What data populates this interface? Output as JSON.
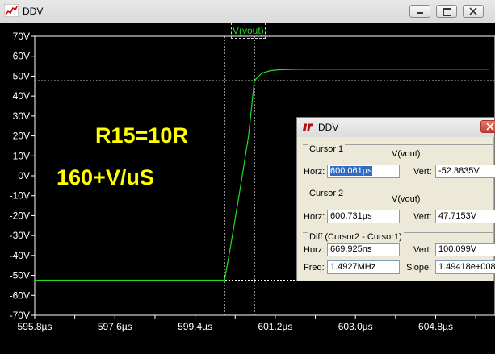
{
  "main_window": {
    "title": "DDV"
  },
  "plot": {
    "trace_label": "V(vout)",
    "y_ticks": [
      "70V",
      "60V",
      "50V",
      "40V",
      "30V",
      "20V",
      "10V",
      "0V",
      "-10V",
      "-20V",
      "-30V",
      "-40V",
      "-50V",
      "-60V",
      "-70V"
    ],
    "x_ticks": [
      "595.8µs",
      "597.6µs",
      "599.4µs",
      "601.2µs",
      "603.0µs",
      "604.8µs"
    ],
    "annotations": [
      "R15=10R",
      "160+V/uS"
    ],
    "colors": {
      "background": "#000000",
      "trace": "#22dd22",
      "annotation": "#ffff00",
      "grid": "#ffffff"
    }
  },
  "chart_data": {
    "type": "line",
    "title": "",
    "xlabel": "",
    "ylabel": "",
    "xlim": [
      595.8,
      606.0
    ],
    "ylim": [
      -70,
      70
    ],
    "x_unit": "µs",
    "y_unit": "V",
    "series": [
      {
        "name": "V(vout)",
        "x": [
          595.8,
          599.0,
          600.0,
          600.061,
          600.2,
          600.4,
          600.6,
          600.731,
          600.9,
          601.1,
          601.3,
          601.6,
          602.0,
          603.0,
          604.8,
          606.0
        ],
        "y": [
          -52.4,
          -52.4,
          -52.4,
          -52.4,
          -35.0,
          -8.0,
          20.0,
          47.7,
          51.5,
          52.8,
          53.2,
          53.4,
          53.5,
          53.5,
          53.5,
          53.5
        ]
      }
    ],
    "cursors": [
      {
        "name": "Cursor 1",
        "x": 600.061,
        "y": -52.3835
      },
      {
        "name": "Cursor 2",
        "x": 600.731,
        "y": 47.7153
      }
    ]
  },
  "cursor_dialog": {
    "title": "DDV",
    "cursor1": {
      "group_label": "Cursor 1",
      "trace": "V(vout)",
      "horz_label": "Horz:",
      "horz_value": "600.061µs",
      "vert_label": "Vert:",
      "vert_value": "-52.3835V"
    },
    "cursor2": {
      "group_label": "Cursor 2",
      "trace": "V(vout)",
      "horz_label": "Horz:",
      "horz_value": "600.731µs",
      "vert_label": "Vert:",
      "vert_value": "47.7153V"
    },
    "diff": {
      "group_label": "Diff (Cursor2 - Cursor1)",
      "horz_label": "Horz:",
      "horz_value": "669.925ns",
      "vert_label": "Vert:",
      "vert_value": "100.099V",
      "freq_label": "Freq:",
      "freq_value": "1.4927MHz",
      "slope_label": "Slope:",
      "slope_value": "1.49418e+008"
    }
  }
}
